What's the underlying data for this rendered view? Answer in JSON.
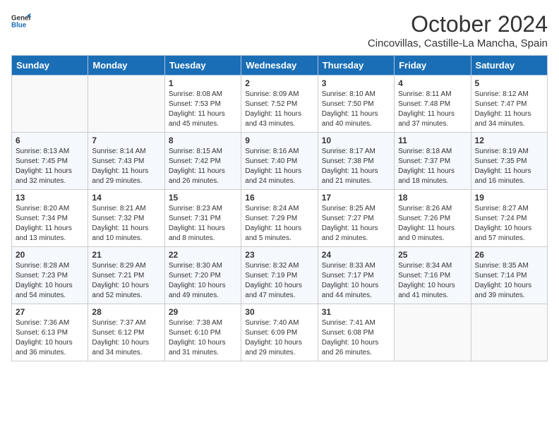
{
  "header": {
    "logo_line1": "General",
    "logo_line2": "Blue",
    "month": "October 2024",
    "location": "Cincovillas, Castille-La Mancha, Spain"
  },
  "weekdays": [
    "Sunday",
    "Monday",
    "Tuesday",
    "Wednesday",
    "Thursday",
    "Friday",
    "Saturday"
  ],
  "weeks": [
    [
      {
        "day": "",
        "sunrise": "",
        "sunset": "",
        "daylight": ""
      },
      {
        "day": "",
        "sunrise": "",
        "sunset": "",
        "daylight": ""
      },
      {
        "day": "1",
        "sunrise": "Sunrise: 8:08 AM",
        "sunset": "Sunset: 7:53 PM",
        "daylight": "Daylight: 11 hours and 45 minutes."
      },
      {
        "day": "2",
        "sunrise": "Sunrise: 8:09 AM",
        "sunset": "Sunset: 7:52 PM",
        "daylight": "Daylight: 11 hours and 43 minutes."
      },
      {
        "day": "3",
        "sunrise": "Sunrise: 8:10 AM",
        "sunset": "Sunset: 7:50 PM",
        "daylight": "Daylight: 11 hours and 40 minutes."
      },
      {
        "day": "4",
        "sunrise": "Sunrise: 8:11 AM",
        "sunset": "Sunset: 7:48 PM",
        "daylight": "Daylight: 11 hours and 37 minutes."
      },
      {
        "day": "5",
        "sunrise": "Sunrise: 8:12 AM",
        "sunset": "Sunset: 7:47 PM",
        "daylight": "Daylight: 11 hours and 34 minutes."
      }
    ],
    [
      {
        "day": "6",
        "sunrise": "Sunrise: 8:13 AM",
        "sunset": "Sunset: 7:45 PM",
        "daylight": "Daylight: 11 hours and 32 minutes."
      },
      {
        "day": "7",
        "sunrise": "Sunrise: 8:14 AM",
        "sunset": "Sunset: 7:43 PM",
        "daylight": "Daylight: 11 hours and 29 minutes."
      },
      {
        "day": "8",
        "sunrise": "Sunrise: 8:15 AM",
        "sunset": "Sunset: 7:42 PM",
        "daylight": "Daylight: 11 hours and 26 minutes."
      },
      {
        "day": "9",
        "sunrise": "Sunrise: 8:16 AM",
        "sunset": "Sunset: 7:40 PM",
        "daylight": "Daylight: 11 hours and 24 minutes."
      },
      {
        "day": "10",
        "sunrise": "Sunrise: 8:17 AM",
        "sunset": "Sunset: 7:38 PM",
        "daylight": "Daylight: 11 hours and 21 minutes."
      },
      {
        "day": "11",
        "sunrise": "Sunrise: 8:18 AM",
        "sunset": "Sunset: 7:37 PM",
        "daylight": "Daylight: 11 hours and 18 minutes."
      },
      {
        "day": "12",
        "sunrise": "Sunrise: 8:19 AM",
        "sunset": "Sunset: 7:35 PM",
        "daylight": "Daylight: 11 hours and 16 minutes."
      }
    ],
    [
      {
        "day": "13",
        "sunrise": "Sunrise: 8:20 AM",
        "sunset": "Sunset: 7:34 PM",
        "daylight": "Daylight: 11 hours and 13 minutes."
      },
      {
        "day": "14",
        "sunrise": "Sunrise: 8:21 AM",
        "sunset": "Sunset: 7:32 PM",
        "daylight": "Daylight: 11 hours and 10 minutes."
      },
      {
        "day": "15",
        "sunrise": "Sunrise: 8:23 AM",
        "sunset": "Sunset: 7:31 PM",
        "daylight": "Daylight: 11 hours and 8 minutes."
      },
      {
        "day": "16",
        "sunrise": "Sunrise: 8:24 AM",
        "sunset": "Sunset: 7:29 PM",
        "daylight": "Daylight: 11 hours and 5 minutes."
      },
      {
        "day": "17",
        "sunrise": "Sunrise: 8:25 AM",
        "sunset": "Sunset: 7:27 PM",
        "daylight": "Daylight: 11 hours and 2 minutes."
      },
      {
        "day": "18",
        "sunrise": "Sunrise: 8:26 AM",
        "sunset": "Sunset: 7:26 PM",
        "daylight": "Daylight: 11 hours and 0 minutes."
      },
      {
        "day": "19",
        "sunrise": "Sunrise: 8:27 AM",
        "sunset": "Sunset: 7:24 PM",
        "daylight": "Daylight: 10 hours and 57 minutes."
      }
    ],
    [
      {
        "day": "20",
        "sunrise": "Sunrise: 8:28 AM",
        "sunset": "Sunset: 7:23 PM",
        "daylight": "Daylight: 10 hours and 54 minutes."
      },
      {
        "day": "21",
        "sunrise": "Sunrise: 8:29 AM",
        "sunset": "Sunset: 7:21 PM",
        "daylight": "Daylight: 10 hours and 52 minutes."
      },
      {
        "day": "22",
        "sunrise": "Sunrise: 8:30 AM",
        "sunset": "Sunset: 7:20 PM",
        "daylight": "Daylight: 10 hours and 49 minutes."
      },
      {
        "day": "23",
        "sunrise": "Sunrise: 8:32 AM",
        "sunset": "Sunset: 7:19 PM",
        "daylight": "Daylight: 10 hours and 47 minutes."
      },
      {
        "day": "24",
        "sunrise": "Sunrise: 8:33 AM",
        "sunset": "Sunset: 7:17 PM",
        "daylight": "Daylight: 10 hours and 44 minutes."
      },
      {
        "day": "25",
        "sunrise": "Sunrise: 8:34 AM",
        "sunset": "Sunset: 7:16 PM",
        "daylight": "Daylight: 10 hours and 41 minutes."
      },
      {
        "day": "26",
        "sunrise": "Sunrise: 8:35 AM",
        "sunset": "Sunset: 7:14 PM",
        "daylight": "Daylight: 10 hours and 39 minutes."
      }
    ],
    [
      {
        "day": "27",
        "sunrise": "Sunrise: 7:36 AM",
        "sunset": "Sunset: 6:13 PM",
        "daylight": "Daylight: 10 hours and 36 minutes."
      },
      {
        "day": "28",
        "sunrise": "Sunrise: 7:37 AM",
        "sunset": "Sunset: 6:12 PM",
        "daylight": "Daylight: 10 hours and 34 minutes."
      },
      {
        "day": "29",
        "sunrise": "Sunrise: 7:38 AM",
        "sunset": "Sunset: 6:10 PM",
        "daylight": "Daylight: 10 hours and 31 minutes."
      },
      {
        "day": "30",
        "sunrise": "Sunrise: 7:40 AM",
        "sunset": "Sunset: 6:09 PM",
        "daylight": "Daylight: 10 hours and 29 minutes."
      },
      {
        "day": "31",
        "sunrise": "Sunrise: 7:41 AM",
        "sunset": "Sunset: 6:08 PM",
        "daylight": "Daylight: 10 hours and 26 minutes."
      },
      {
        "day": "",
        "sunrise": "",
        "sunset": "",
        "daylight": ""
      },
      {
        "day": "",
        "sunrise": "",
        "sunset": "",
        "daylight": ""
      }
    ]
  ]
}
